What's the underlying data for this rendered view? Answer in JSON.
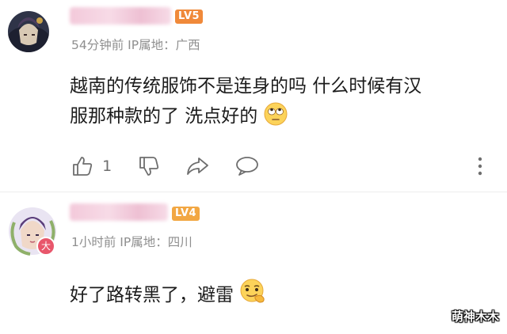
{
  "comments": [
    {
      "level": "LV5",
      "level_color": "#f0893a",
      "meta": "54分钟前 IP属地：广西",
      "text_lines": [
        "越南的传统服饰不是连身的吗 什么时候有汉",
        "服那种款的了 洗点好的"
      ],
      "emoji": "eye-roll-emoji",
      "like_count": "1",
      "actions": [
        "thumb-up-icon",
        "thumb-down-icon",
        "share-icon",
        "comment-icon",
        "more-icon"
      ]
    },
    {
      "level": "LV4",
      "level_color": "#f2a743",
      "meta": "1小时前 IP属地：四川",
      "badge": "大",
      "text_lines": [
        "好了路转黑了，避雷"
      ],
      "emoji": "smirk-emoji"
    }
  ],
  "watermark": "萌神木木"
}
